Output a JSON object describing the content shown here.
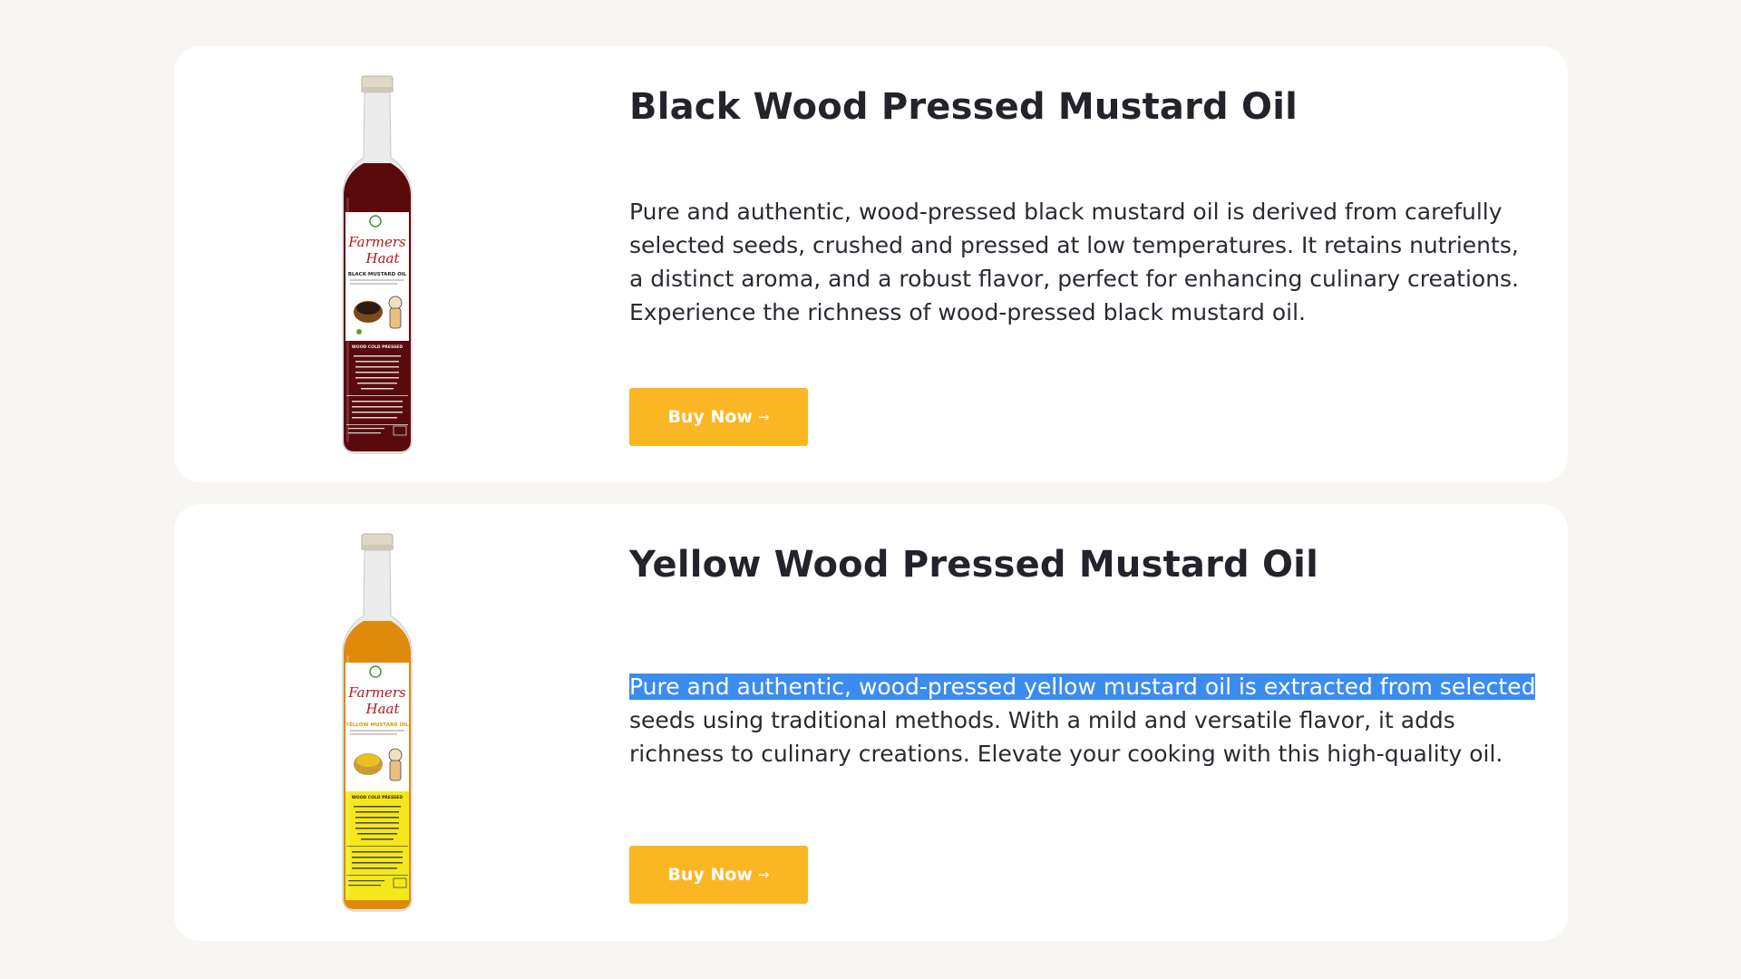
{
  "products": [
    {
      "title": "Black Wood Pressed Mustard Oil",
      "description": "Pure and authentic, wood-pressed black mustard oil is derived from carefully selected seeds, crushed and pressed at low temperatures. It retains nutrients, a distinct aroma, and a robust flavor, perfect for enhancing culinary creations. Experience the richness of wood-pressed black mustard oil.",
      "button_label": "Buy Now",
      "button_arrow": "→",
      "label": {
        "brand_line1": "Farmers",
        "brand_line2": "Haat",
        "oil_name": "BLACK MUSTARD OIL",
        "badge": "WOOD COLD PRESSED"
      },
      "oil_color": "#5a0a0c"
    },
    {
      "title": "Yellow Wood Pressed Mustard Oil",
      "description_highlighted": "Pure and authentic, wood-pressed yellow mustard oil is extracted from selected",
      "description_rest": " seeds using traditional methods. With a mild and versatile flavor, it adds richness to culinary creations. Elevate your cooking with this high-quality oil.",
      "button_label": "Buy Now",
      "button_arrow": "→",
      "label": {
        "brand_line1": "Farmers",
        "brand_line2": "Haat",
        "oil_name": "YELLOW MUSTARD OIL",
        "badge": "WOOD COLD PRESSED"
      },
      "oil_color": "#e08a0c"
    }
  ],
  "colors": {
    "page_background": "#f8f6f2",
    "card_background": "#ffffff",
    "button": "#fbb624",
    "selection": "#3c8cf0"
  }
}
